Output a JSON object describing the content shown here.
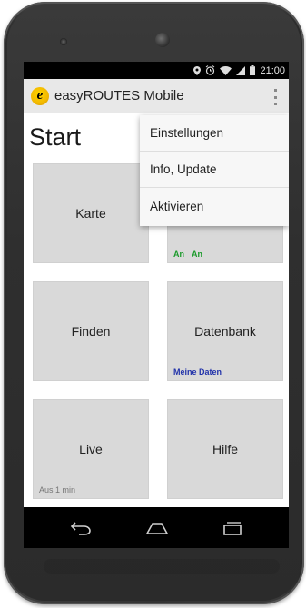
{
  "status_bar": {
    "time": "21:00",
    "icons": [
      "location-icon",
      "alarm-icon",
      "wifi-icon",
      "signal-icon",
      "battery-icon"
    ]
  },
  "action_bar": {
    "logo_letter": "e",
    "title": "easyROUTES Mobile",
    "overflow_icon": "overflow-menu-icon"
  },
  "page": {
    "title": "Start"
  },
  "tiles": [
    {
      "label": "Karte",
      "sub": ""
    },
    {
      "label": "",
      "sub_left": "An",
      "sub_right": "An"
    },
    {
      "label": "Finden",
      "sub": ""
    },
    {
      "label": "Datenbank",
      "sub": "Meine Daten"
    },
    {
      "label": "Live",
      "sub": "Aus 1 min"
    },
    {
      "label": "Hilfe",
      "sub": ""
    }
  ],
  "overflow_menu": {
    "items": [
      {
        "label": "Einstellungen"
      },
      {
        "label": "Info, Update"
      },
      {
        "label": "Aktivieren"
      }
    ]
  },
  "nav_bar": {
    "icons": [
      "back-icon",
      "home-icon",
      "recents-icon"
    ]
  },
  "colors": {
    "status_on": "#1a9a2a",
    "link_blue": "#2233aa",
    "sub_gray": "#777777",
    "tile_bg": "#d9d9d9",
    "logo_yellow": "#f2b800"
  }
}
